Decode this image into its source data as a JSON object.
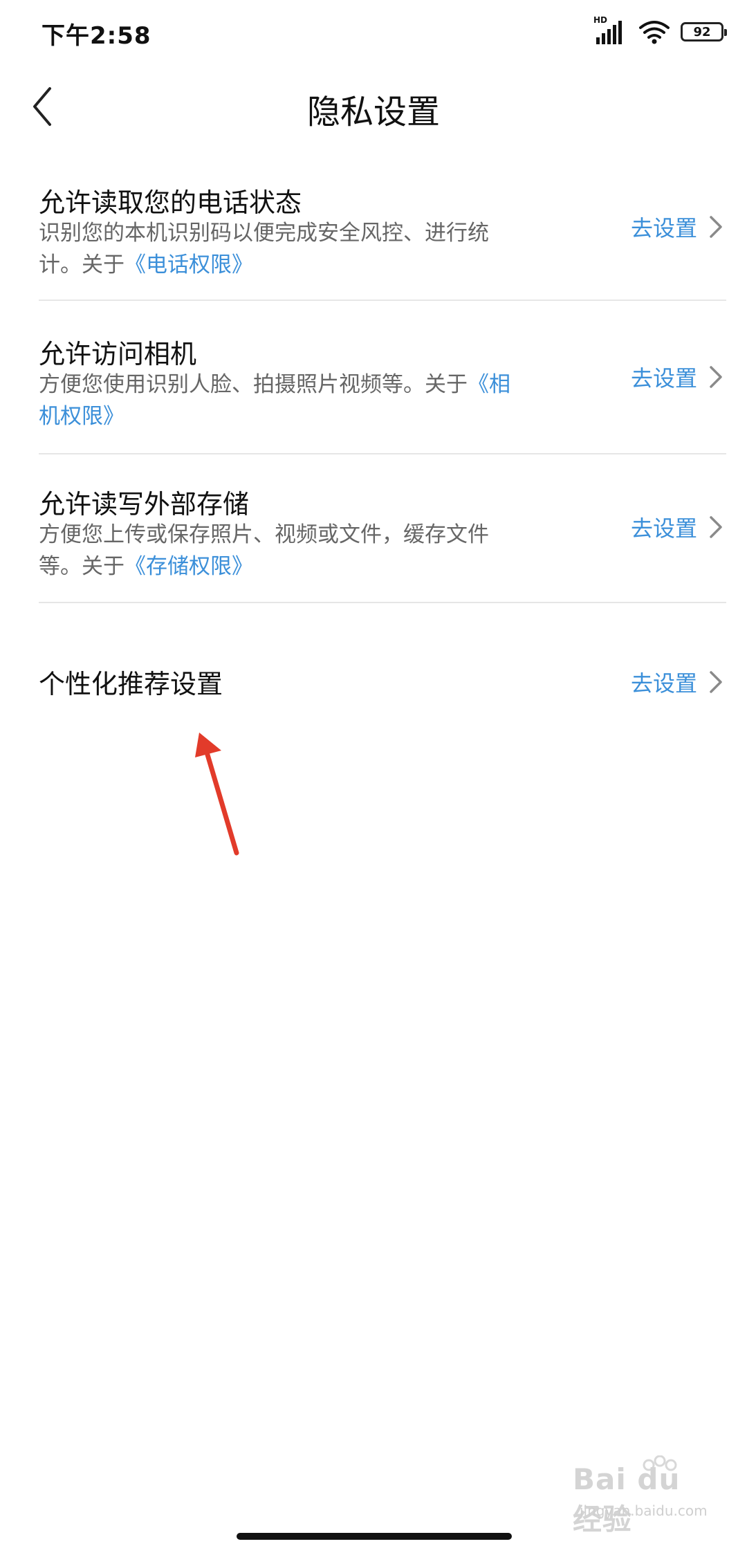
{
  "status_bar": {
    "time": "下午2:58",
    "network_label": "HD",
    "battery": "92"
  },
  "header": {
    "title": "隐私设置"
  },
  "settings": [
    {
      "title": "允许读取您的电话状态",
      "desc_line1": "识别您的本机识别码以便完成安全风控、进行统",
      "desc_line2_prefix": "计。关于",
      "desc_line1_link": "",
      "desc_line2_link": "《电话权限》",
      "action": "去设置"
    },
    {
      "title": "允许访问相机",
      "desc_line1": "方便您使用识别人脸、拍摄照片视频等。关于",
      "desc_line1_link": "《相",
      "desc_line2_prefix": "",
      "desc_line2_link": "机权限》",
      "action": "去设置"
    },
    {
      "title": "允许读写外部存储",
      "desc_line1": "方便您上传或保存照片、视频或文件，缓存文件",
      "desc_line1_link": "",
      "desc_line2_prefix": "等。关于",
      "desc_line2_link": "《存储权限》",
      "action": "去设置"
    },
    {
      "title": "个性化推荐设置",
      "action": "去设置"
    }
  ],
  "watermark": {
    "logo": "Bai du 经验",
    "url": "jingyan.baidu.com"
  },
  "colors": {
    "link": "#3b8fd9",
    "annotation_arrow": "#e23b2a"
  },
  "icons": {
    "back": "chevron-left-icon",
    "row_arrow": "chevron-right-icon"
  }
}
